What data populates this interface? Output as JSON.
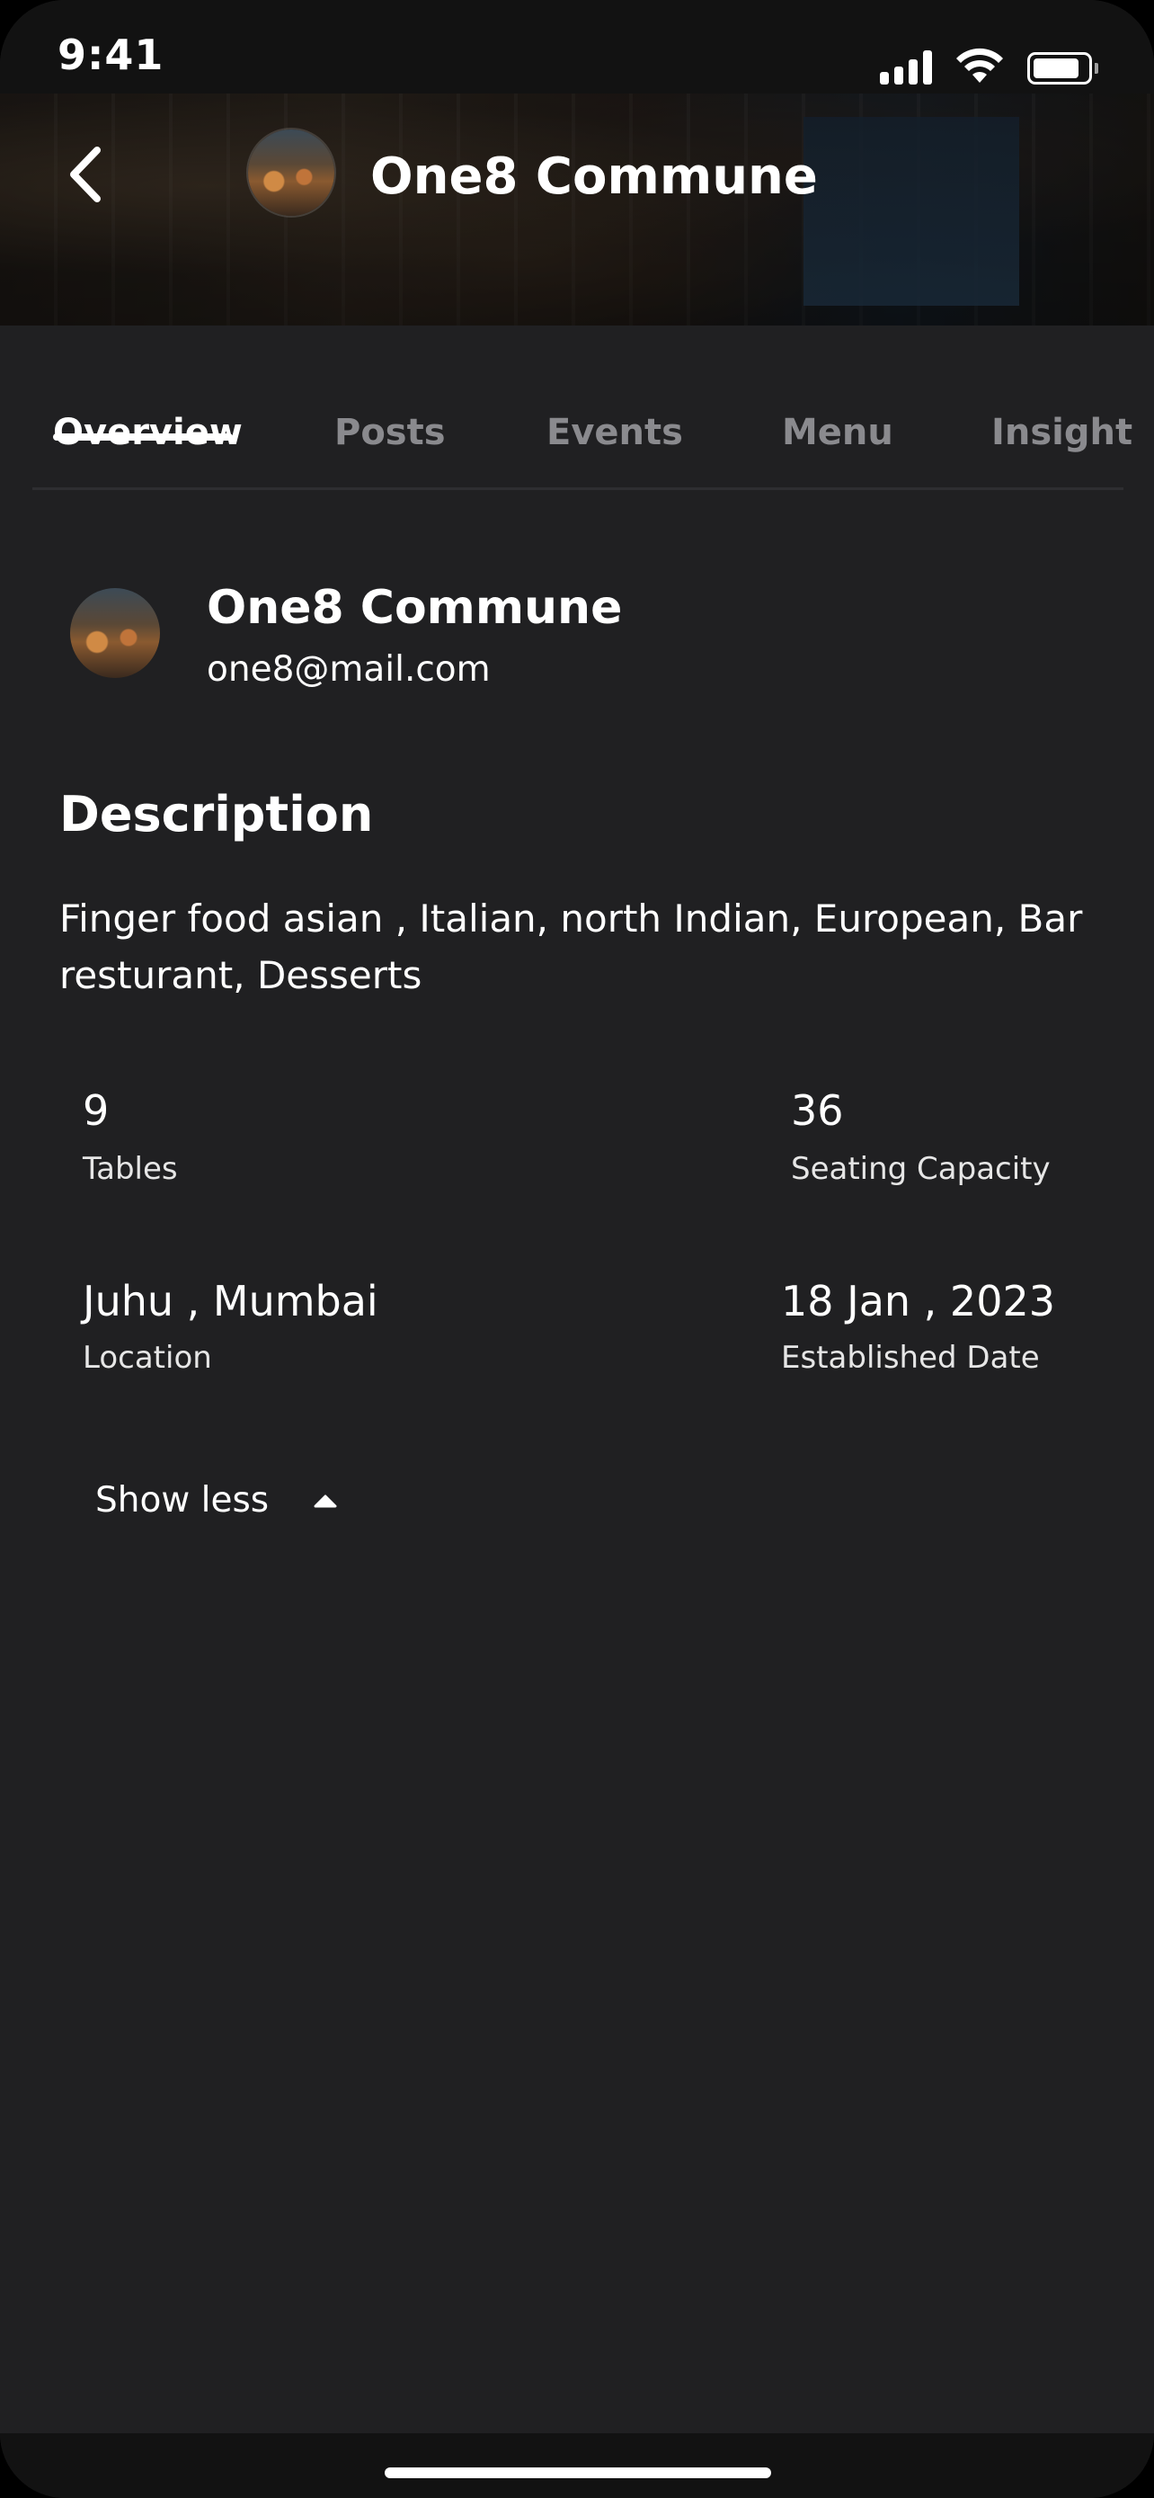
{
  "status_bar": {
    "time": "9:41"
  },
  "header": {
    "title": "One8 Commune",
    "back_icon": "chevron-left-icon"
  },
  "tabs": [
    {
      "label": "Overview",
      "active": true
    },
    {
      "label": "Posts",
      "active": false
    },
    {
      "label": "Events",
      "active": false
    },
    {
      "label": "Menu",
      "active": false
    },
    {
      "label": "Insight",
      "active": false
    }
  ],
  "profile": {
    "name": "One8 Commune",
    "email": "one8@mail.com"
  },
  "description": {
    "heading": "Description",
    "text": "Finger food asian , Italian, north Indian, European, Bar resturant, Desserts"
  },
  "stats": [
    {
      "value": "9",
      "label": "Tables"
    },
    {
      "value": "36",
      "label": "Seating Capacity"
    },
    {
      "value": "Juhu , Mumbai",
      "label": "Location"
    },
    {
      "value": "18 Jan , 2023",
      "label": "Established Date"
    }
  ],
  "toggle": {
    "label": "Show less",
    "icon": "caret-up-icon"
  },
  "colors": {
    "background": "#202022",
    "status_bar": "#121212",
    "text_primary": "#ffffff",
    "text_muted": "#8a8a8e"
  }
}
